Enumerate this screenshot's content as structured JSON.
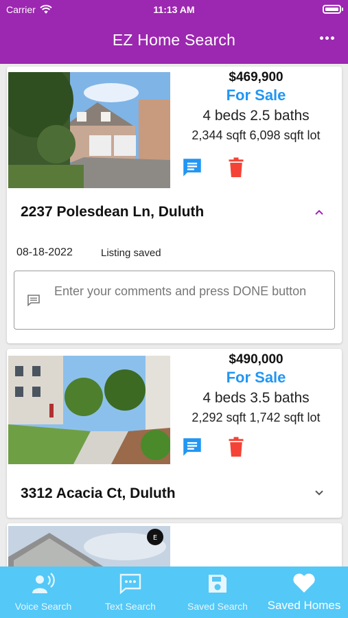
{
  "status_bar": {
    "carrier": "Carrier",
    "time": "11:13 AM"
  },
  "header": {
    "title": "EZ Home Search",
    "menu_icon": "more-horizontal-icon"
  },
  "listings": [
    {
      "price": "$469,900",
      "status": "For Sale",
      "beds_baths": "4 beds 2.5 baths",
      "sqft": "2,344 sqft 6,098 sqft lot",
      "address": "2237 Polesdean Ln, Duluth",
      "expanded": true,
      "date": "08-18-2022",
      "note": "Listing saved",
      "comment_placeholder": "Enter your comments and press DONE button"
    },
    {
      "price": "$490,000",
      "status": "For Sale",
      "beds_baths": "4 beds 3.5 baths",
      "sqft": "2,292 sqft 1,742 sqft lot",
      "address": "3312 Acacia Ct, Duluth",
      "expanded": false
    }
  ],
  "tabs": [
    {
      "label": "Voice Search",
      "icon": "voice-search-icon"
    },
    {
      "label": "Text Search",
      "icon": "text-search-icon"
    },
    {
      "label": "Saved Search",
      "icon": "save-icon"
    },
    {
      "label": "Saved Homes",
      "icon": "heart-icon",
      "active": true
    }
  ],
  "colors": {
    "header": "#9c27b0",
    "status_text": "#2196f3",
    "comment_icon": "#2196f3",
    "delete_icon": "#f44336",
    "tab_bar": "#54c8f7"
  }
}
